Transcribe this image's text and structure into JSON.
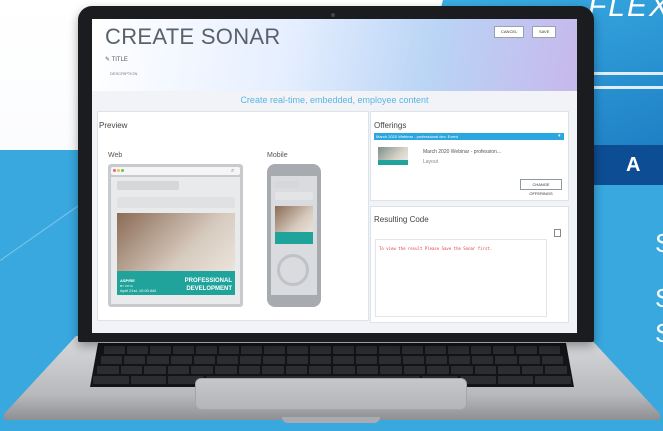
{
  "background": {
    "side_word": "FLEX",
    "banner_text": "A",
    "side_letters": [
      "S",
      "S",
      "S"
    ],
    "accent": "#38a8df",
    "dark_accent": "#0d4d94"
  },
  "app": {
    "title": "CREATE SONAR",
    "title_field_label": "TITLE",
    "description_label": "DESCRIPTION",
    "cancel_label": "CANCEL",
    "save_label": "SAVE",
    "tagline": "Create real-time, embedded, employee content"
  },
  "preview": {
    "heading": "Preview",
    "web_label": "Web",
    "mobile_label": "Mobile"
  },
  "promo": {
    "logo_line1": "ASPIRE",
    "logo_line2": "BY VOYA",
    "line1": "PROFESSIONAL",
    "line2": "DEVELOPMENT",
    "date": "April 21st, 10:00 AM"
  },
  "offerings": {
    "heading": "Offerings",
    "selected": "March 2020 Webinar - professional dev. Event",
    "item_title": "March 2020 Webinar - profession...",
    "item_type": "Layout",
    "change_button": "CHANGE OFFERINGS"
  },
  "resulting_code": {
    "heading": "Resulting Code",
    "message": "To view the result Please Save the Sonar first."
  }
}
